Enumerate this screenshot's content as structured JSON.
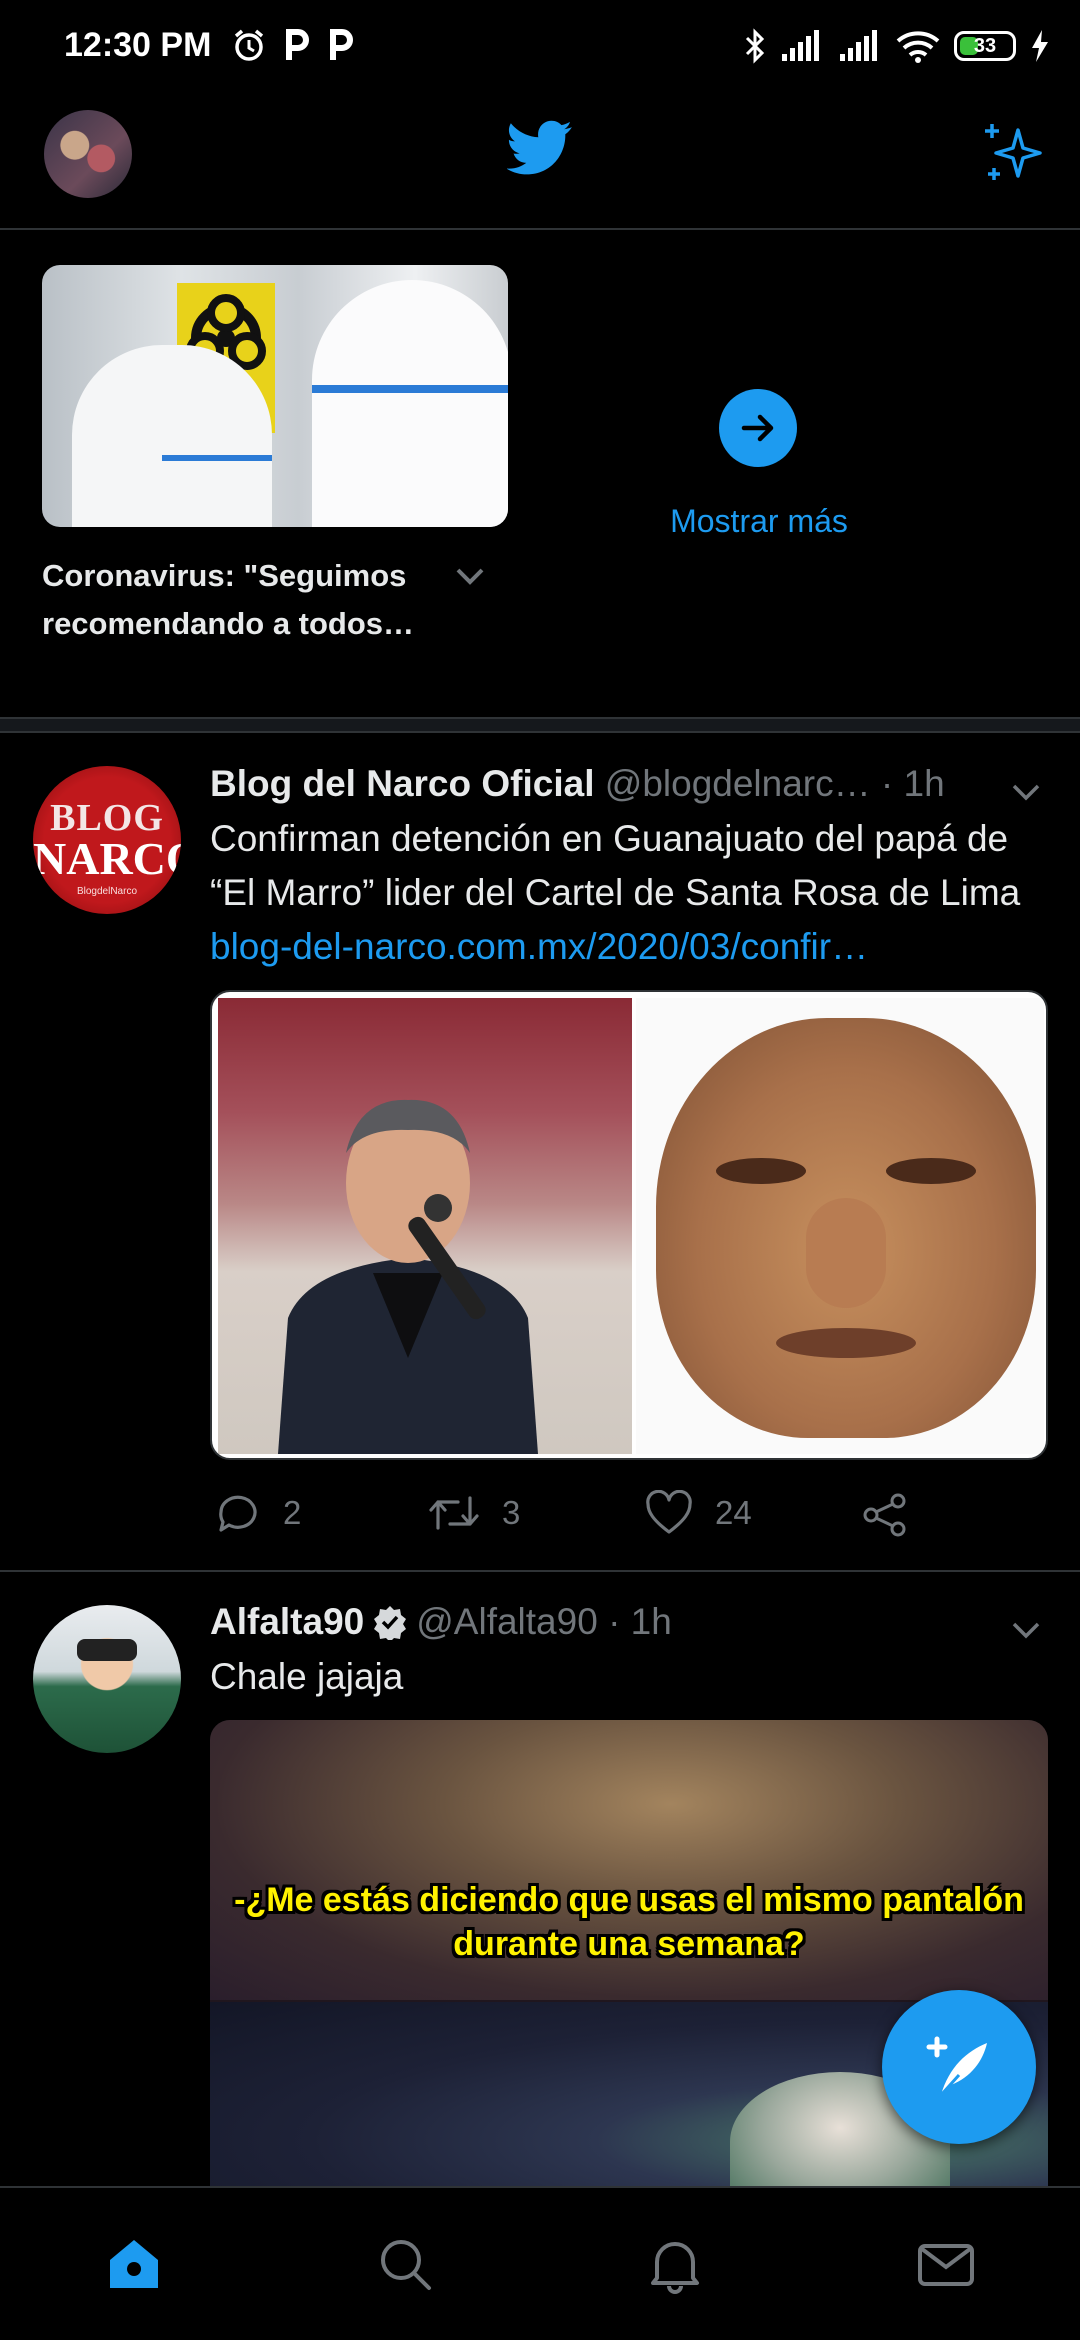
{
  "status_bar": {
    "time": "12:30 PM",
    "battery_level": "33",
    "icons_left": [
      "alarm-icon",
      "parking-p-icon",
      "parking-p-icon"
    ],
    "icons_right": [
      "bluetooth-icon",
      "signal-icon",
      "signal-icon",
      "wifi-icon",
      "battery-icon",
      "charging-bolt-icon"
    ]
  },
  "header": {
    "profile_avatar": "profile-avatar",
    "logo": "twitter-bird-icon",
    "sparkle": "sparkle-icon"
  },
  "moment": {
    "title": "Coronavirus: \"Seguimos recomendando a todos…",
    "show_more_label": "Mostrar más"
  },
  "tweets": [
    {
      "name": "Blog del Narco Oficial",
      "handle": "@blogdelnarc…",
      "time": "· 1h",
      "avatar_text": [
        "BLOG",
        "NARCO",
        "BlogdelNarco"
      ],
      "text": "Confirman detención en Guanajuato del papá de “El Marro” lider del Cartel de Santa Rosa de Lima ",
      "link": "blog-del-narco.com.mx/2020/03/confir…",
      "replies": "2",
      "retweets": "3",
      "likes": "24"
    },
    {
      "name": "Alfalta90",
      "handle": "@Alfalta90",
      "time": "· 1h",
      "text": "Chale jajaja",
      "meme_caption": "-¿Me estás diciendo que usas el mismo pantalón durante una semana?"
    }
  ],
  "bottom_nav": [
    "home-icon",
    "search-icon",
    "notifications-bell-icon",
    "messages-mail-icon"
  ],
  "colors": {
    "accent": "#1d9bf0",
    "background": "#000000",
    "divider": "#2f3336",
    "muted": "#71767b"
  }
}
